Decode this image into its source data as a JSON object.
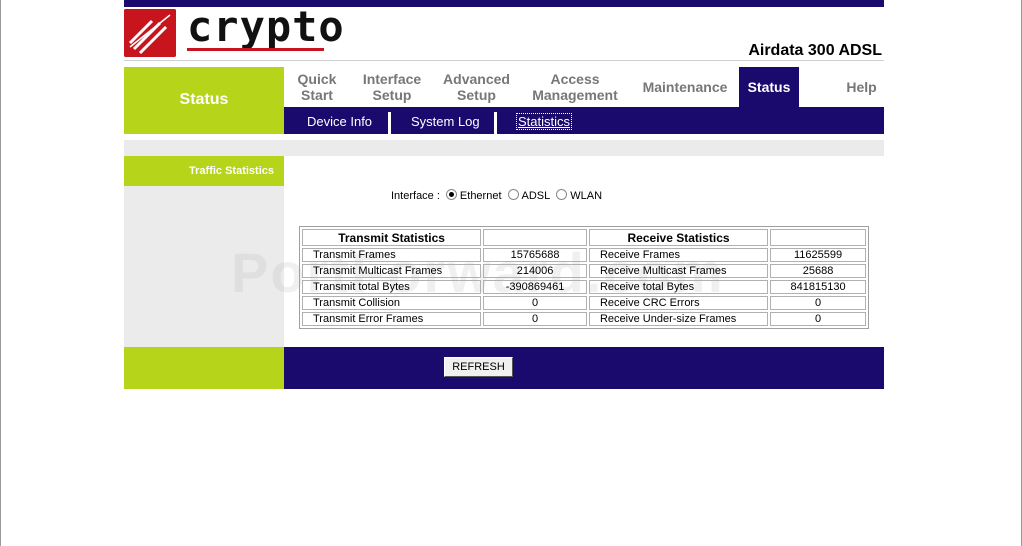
{
  "brand": {
    "logo_text": "crypto",
    "model": "Airdata 300 ADSL"
  },
  "colors": {
    "navy": "#1a0a6e",
    "green": "#b5d41a",
    "red": "#c8141c"
  },
  "left_header": "Status",
  "nav": {
    "items": [
      {
        "label": "Quick\nStart"
      },
      {
        "label": "Interface\nSetup"
      },
      {
        "label": "Advanced\nSetup"
      },
      {
        "label": "Access\nManagement"
      },
      {
        "label": "Maintenance"
      },
      {
        "label": "Status",
        "active": true
      },
      {
        "label": "Help"
      }
    ]
  },
  "subnav": {
    "items": [
      {
        "label": "Device Info"
      },
      {
        "label": "System Log"
      },
      {
        "label": "Statistics",
        "active": true
      }
    ]
  },
  "sidebar": {
    "section_label": "Traffic Statistics"
  },
  "interface": {
    "label": "Interface :",
    "options": [
      "Ethernet",
      "ADSL",
      "WLAN"
    ],
    "selected": "Ethernet"
  },
  "stats": {
    "transmit_header": "Transmit Statistics",
    "receive_header": "Receive Statistics",
    "rows": [
      {
        "tx_label": "Transmit Frames",
        "tx_value": "15765688",
        "rx_label": "Receive Frames",
        "rx_value": "11625599"
      },
      {
        "tx_label": "Transmit Multicast Frames",
        "tx_value": "214006",
        "rx_label": "Receive Multicast Frames",
        "rx_value": "25688"
      },
      {
        "tx_label": "Transmit total Bytes",
        "tx_value": "-390869461",
        "rx_label": "Receive total Bytes",
        "rx_value": "841815130"
      },
      {
        "tx_label": "Transmit Collision",
        "tx_value": "0",
        "rx_label": "Receive CRC Errors",
        "rx_value": "0"
      },
      {
        "tx_label": "Transmit Error Frames",
        "tx_value": "0",
        "rx_label": "Receive Under-size Frames",
        "rx_value": "0"
      }
    ]
  },
  "refresh_label": "REFRESH",
  "watermark": "PortForward.com"
}
